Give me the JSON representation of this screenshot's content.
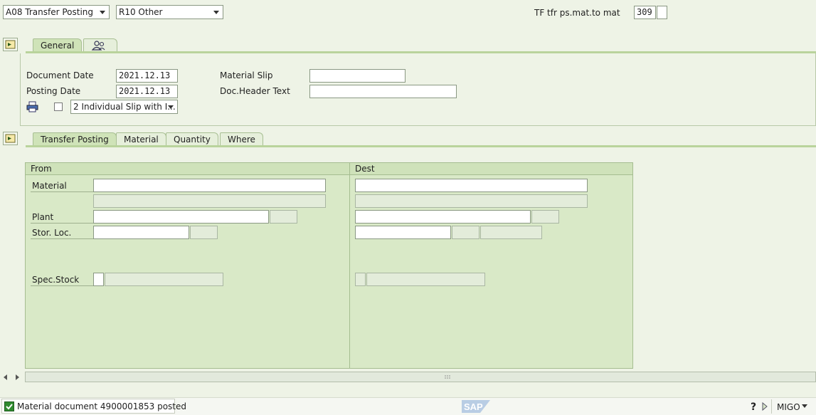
{
  "header": {
    "action": "A08 Transfer Posting",
    "ref": "R10 Other",
    "movement_label": "TF tfr ps.mat.to mat",
    "movement_type": "309"
  },
  "general": {
    "tabs": [
      "General"
    ],
    "person_tab_icon": "person-icon",
    "document_date_label": "Document Date",
    "document_date": "2021.12.13",
    "posting_date_label": "Posting Date",
    "posting_date": "2021.12.13",
    "material_slip_label": "Material Slip",
    "doc_header_text_label": "Doc.Header Text",
    "print_icon": "printer-icon",
    "print_version": "2 Individual Slip with I..."
  },
  "detail": {
    "tabs": [
      "Transfer Posting",
      "Material",
      "Quantity",
      "Where"
    ],
    "from_title": "From",
    "dest_title": "Dest",
    "material_label": "Material",
    "plant_label": "Plant",
    "sloc_label": "Stor. Loc.",
    "spec_stock_label": "Spec.Stock"
  },
  "status": {
    "message": "Material document 4900001853 posted",
    "transaction": "MIGO",
    "logo": "SAP"
  },
  "colors": {
    "background": "#eef3e6",
    "panel": "#d9e9c7",
    "tab_line": "#b9d39c"
  }
}
